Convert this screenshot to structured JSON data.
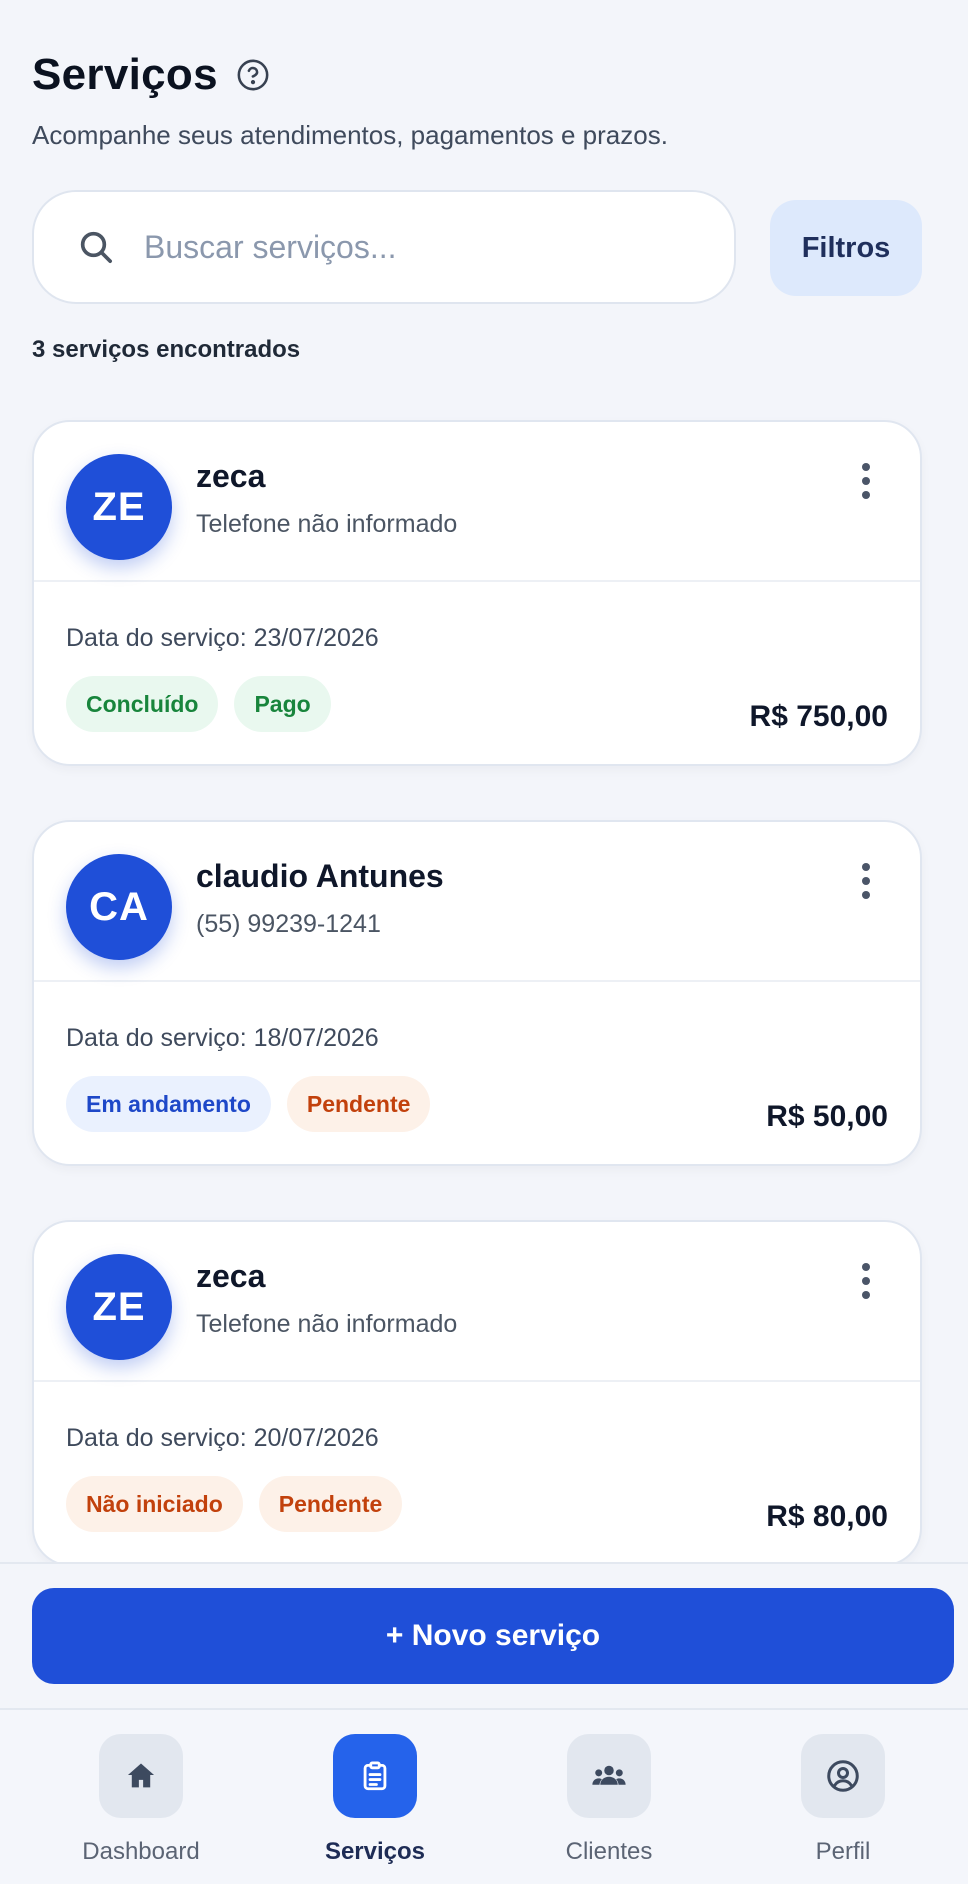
{
  "header": {
    "title": "Serviços",
    "subtitle": "Acompanhe seus atendimentos, pagamentos e prazos."
  },
  "search": {
    "placeholder": "Buscar serviços...",
    "value": ""
  },
  "filters_label": "Filtros",
  "results_count": "3 serviços encontrados",
  "services": [
    {
      "initials": "ZE",
      "name": "zeca",
      "phone": "Telefone não informado",
      "date": "Data do serviço: 23/07/2026",
      "status": "Concluído",
      "payment": "Pago",
      "amount": "R$ 750,00"
    },
    {
      "initials": "CA",
      "name": "claudio Antunes",
      "phone": "(55) 99239-1241",
      "date": "Data do serviço: 18/07/2026",
      "status": "Em andamento",
      "payment": "Pendente",
      "amount": "R$ 50,00"
    },
    {
      "initials": "ZE",
      "name": "zeca",
      "phone": "Telefone não informado",
      "date": "Data do serviço: 20/07/2026",
      "status": "Não iniciado",
      "payment": "Pendente",
      "amount": "R$ 80,00"
    }
  ],
  "new_service_label": "+ Novo serviço",
  "nav": {
    "dashboard": "Dashboard",
    "services": "Serviços",
    "clients": "Clientes",
    "profile": "Perfil"
  },
  "colors": {
    "primary": "#1f4fd8",
    "nav_active": "#2563eb",
    "tag_green": "#18853c",
    "tag_blue": "#1e48c8",
    "tag_orange": "#c2410c"
  },
  "icons": {
    "help": "help-circle-icon",
    "search": "search-icon",
    "more": "more-vertical-icon",
    "dashboard": "home-icon",
    "services": "clipboard-icon",
    "clients": "users-icon",
    "profile": "user-circle-icon"
  }
}
